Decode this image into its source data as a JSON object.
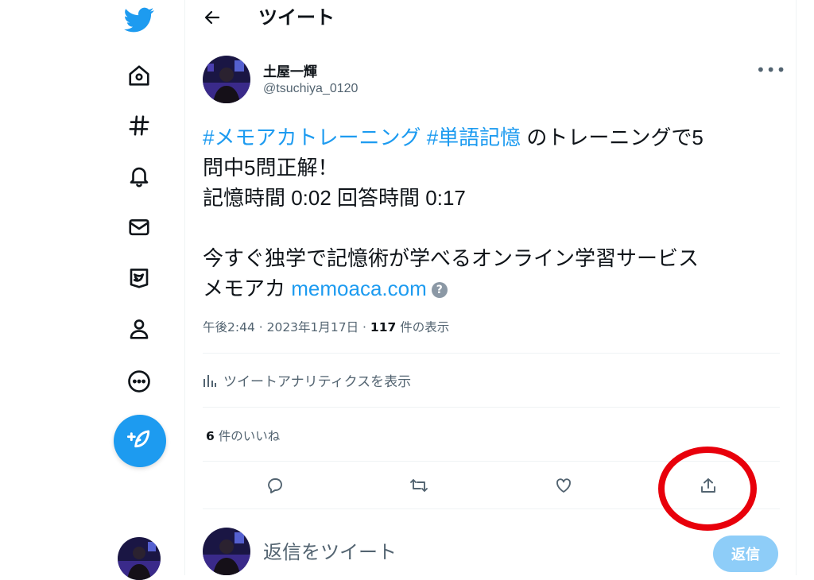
{
  "header": {
    "title": "ツイート"
  },
  "nav": {
    "items": [
      "twitter-logo",
      "home-icon",
      "hashtag-icon",
      "bell-icon",
      "mail-icon",
      "bookmark-icon",
      "profile-icon",
      "more-icon"
    ],
    "compose_icon": "compose-icon"
  },
  "tweet": {
    "author_name": "土屋一輝",
    "author_handle": "@tsuchiya_0120",
    "hashtag1": "#メモアカトレーニング",
    "hashtag2": "#単語記憶",
    "text_line1_rest": "のトレーニングで5",
    "text_line2": "問中5問正解！",
    "text_line3": "記憶時間 0:02 回答時間 0:17",
    "text_line5": "今すぐ独学で記憶術が学べるオンライン学習サービス",
    "text_line6_prefix": "メモアカ",
    "link": "memoaca.com",
    "help_glyph": "?",
    "time": "午後2:44",
    "date": "2023年1月17日",
    "views_count": "117",
    "views_label": "件の表示",
    "analytics_label": "ツイートアナリティクスを表示",
    "likes_count": "6",
    "likes_label": "件のいいね"
  },
  "reply": {
    "placeholder": "返信をツイート",
    "button_label": "返信"
  },
  "colors": {
    "accent": "#1d9bf0",
    "highlight_circle": "#e8000b",
    "reply_button_disabled": "#8ecdf8"
  }
}
